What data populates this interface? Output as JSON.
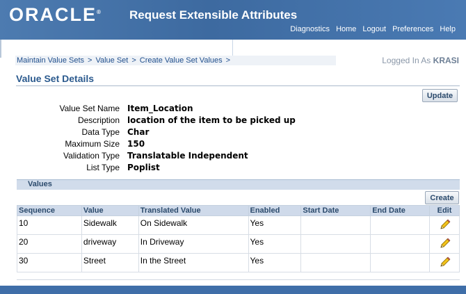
{
  "header": {
    "logo": "ORACLE",
    "logo_mark": "®",
    "app_title": "Request Extensible Attributes",
    "links": [
      "Diagnostics",
      "Home",
      "Logout",
      "Preferences",
      "Help"
    ]
  },
  "breadcrumb": {
    "items": [
      "Maintain Value Sets",
      "Value Set",
      "Create Value Set Values"
    ],
    "separator": ">"
  },
  "login": {
    "prefix": "Logged In As",
    "user": "KRASI"
  },
  "page_title": "Value Set Details",
  "buttons": {
    "update": "Update",
    "create": "Create"
  },
  "details": [
    {
      "label": "Value Set Name",
      "value": "Item_Location"
    },
    {
      "label": "Description",
      "value": "location of the item to be picked up"
    },
    {
      "label": "Data Type",
      "value": "Char"
    },
    {
      "label": "Maximum Size",
      "value": "150"
    },
    {
      "label": "Validation Type",
      "value": "Translatable Independent"
    },
    {
      "label": "List Type",
      "value": "Poplist"
    }
  ],
  "values_section": {
    "title": "Values",
    "columns": [
      "Sequence",
      "Value",
      "Translated Value",
      "Enabled",
      "Start Date",
      "End Date",
      "Edit"
    ],
    "rows": [
      {
        "sequence": "10",
        "value": "Sidewalk",
        "translated": "On Sidewalk",
        "enabled": "Yes",
        "start": "",
        "end": ""
      },
      {
        "sequence": "20",
        "value": "driveway",
        "translated": "In Driveway",
        "enabled": "Yes",
        "start": "",
        "end": ""
      },
      {
        "sequence": "30",
        "value": "Street",
        "translated": "In the Street",
        "enabled": "Yes",
        "start": "",
        "end": ""
      }
    ]
  },
  "icons": {
    "edit": "pencil-icon"
  },
  "colors": {
    "brand": "#3d6aa0",
    "link": "#1f4e8c",
    "section_bar": "#d1dceb"
  }
}
